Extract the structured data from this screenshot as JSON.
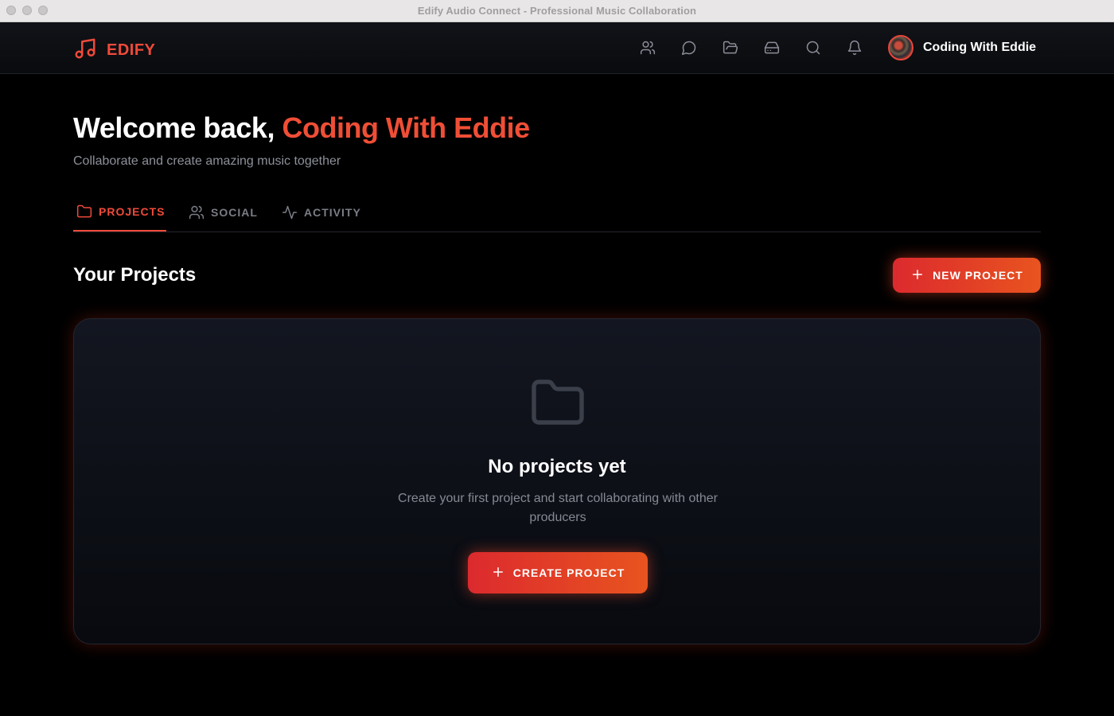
{
  "window": {
    "title": "Edify Audio Connect - Professional Music Collaboration"
  },
  "header": {
    "brand_name": "EDIFY",
    "brand_icon": "music-note-icon",
    "nav_icons": [
      "users-icon",
      "chat-bubble-icon",
      "folder-open-icon",
      "inbox-drive-icon",
      "search-icon",
      "bell-icon"
    ],
    "user_name": "Coding With Eddie"
  },
  "welcome": {
    "greeting": "Welcome back,",
    "name": "Coding With Eddie",
    "subtitle": "Collaborate and create amazing music together"
  },
  "tabs": [
    {
      "label": "PROJECTS",
      "icon": "folder-icon",
      "active": true
    },
    {
      "label": "SOCIAL",
      "icon": "users-icon",
      "active": false
    },
    {
      "label": "ACTIVITY",
      "icon": "activity-pulse-icon",
      "active": false
    }
  ],
  "projects": {
    "heading": "Your Projects",
    "new_button": "NEW PROJECT",
    "empty": {
      "icon": "folder-icon",
      "title": "No projects yet",
      "text": "Create your first project and start collaborating with other producers",
      "button": "CREATE PROJECT"
    }
  },
  "colors": {
    "accent": "#ef4a3a",
    "accent_gradient_start": "#dc2a2e",
    "accent_gradient_end": "#e8541f",
    "background": "#000000"
  }
}
